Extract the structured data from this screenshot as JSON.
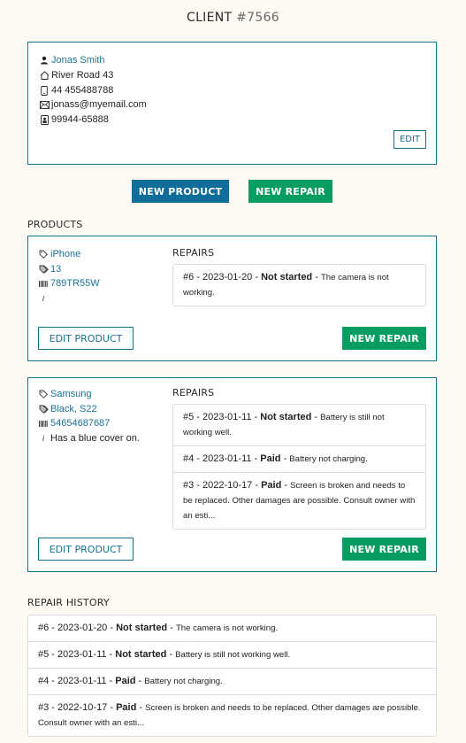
{
  "header": {
    "title_prefix": "CLIENT",
    "client_number": "#7566"
  },
  "client": {
    "name": "Jonas Smith",
    "address": "River Road 43",
    "phone": "44 455488788",
    "email": "jonass@myemail.com",
    "id_number": "99944-65888",
    "edit_label": "EDIT",
    "icons": [
      "person-icon",
      "home-icon",
      "phone-icon",
      "mail-icon",
      "id-card-icon"
    ]
  },
  "actions": {
    "new_product_label": "NEW PRODUCT",
    "new_repair_label": "NEW REPAIR"
  },
  "colors": {
    "primary": "#0f6d99",
    "success": "#069e60",
    "border": "#15728f",
    "background": "#fef9f2",
    "link": "#19749a"
  },
  "products": {
    "section_label": "PRODUCTS",
    "repairs_label": "REPAIRS",
    "edit_label": "EDIT PRODUCT",
    "new_repair_label": "NEW REPAIR",
    "items": [
      {
        "brand": "iPhone",
        "model": "13",
        "serial": "789TR55W",
        "note": "",
        "repairs": [
          {
            "id": "#6",
            "date": "2023-01-20",
            "status": "Not started",
            "description": "The camera is not working."
          }
        ]
      },
      {
        "brand": "Samsung",
        "model": "Black, S22",
        "serial": "54654687687",
        "note": "Has a blue cover on.",
        "repairs": [
          {
            "id": "#5",
            "date": "2023-01-11",
            "status": "Not started",
            "description": "Battery is still not working well."
          },
          {
            "id": "#4",
            "date": "2023-01-11",
            "status": "Paid",
            "description": "Battery not charging."
          },
          {
            "id": "#3",
            "date": "2022-10-17",
            "status": "Paid",
            "description": "Screen is broken and needs to be replaced. Other damages are possible. Consult owner with an esti..."
          }
        ]
      }
    ]
  },
  "history": {
    "section_label": "REPAIR HISTORY",
    "items": [
      {
        "id": "#6",
        "date": "2023-01-20",
        "status": "Not started",
        "description": "The camera is not working."
      },
      {
        "id": "#5",
        "date": "2023-01-11",
        "status": "Not started",
        "description": "Battery is still not working well."
      },
      {
        "id": "#4",
        "date": "2023-01-11",
        "status": "Paid",
        "description": "Battery not charging."
      },
      {
        "id": "#3",
        "date": "2022-10-17",
        "status": "Paid",
        "description": "Screen is broken and needs to be replaced. Other damages are possible. Consult owner with an esti..."
      }
    ]
  }
}
